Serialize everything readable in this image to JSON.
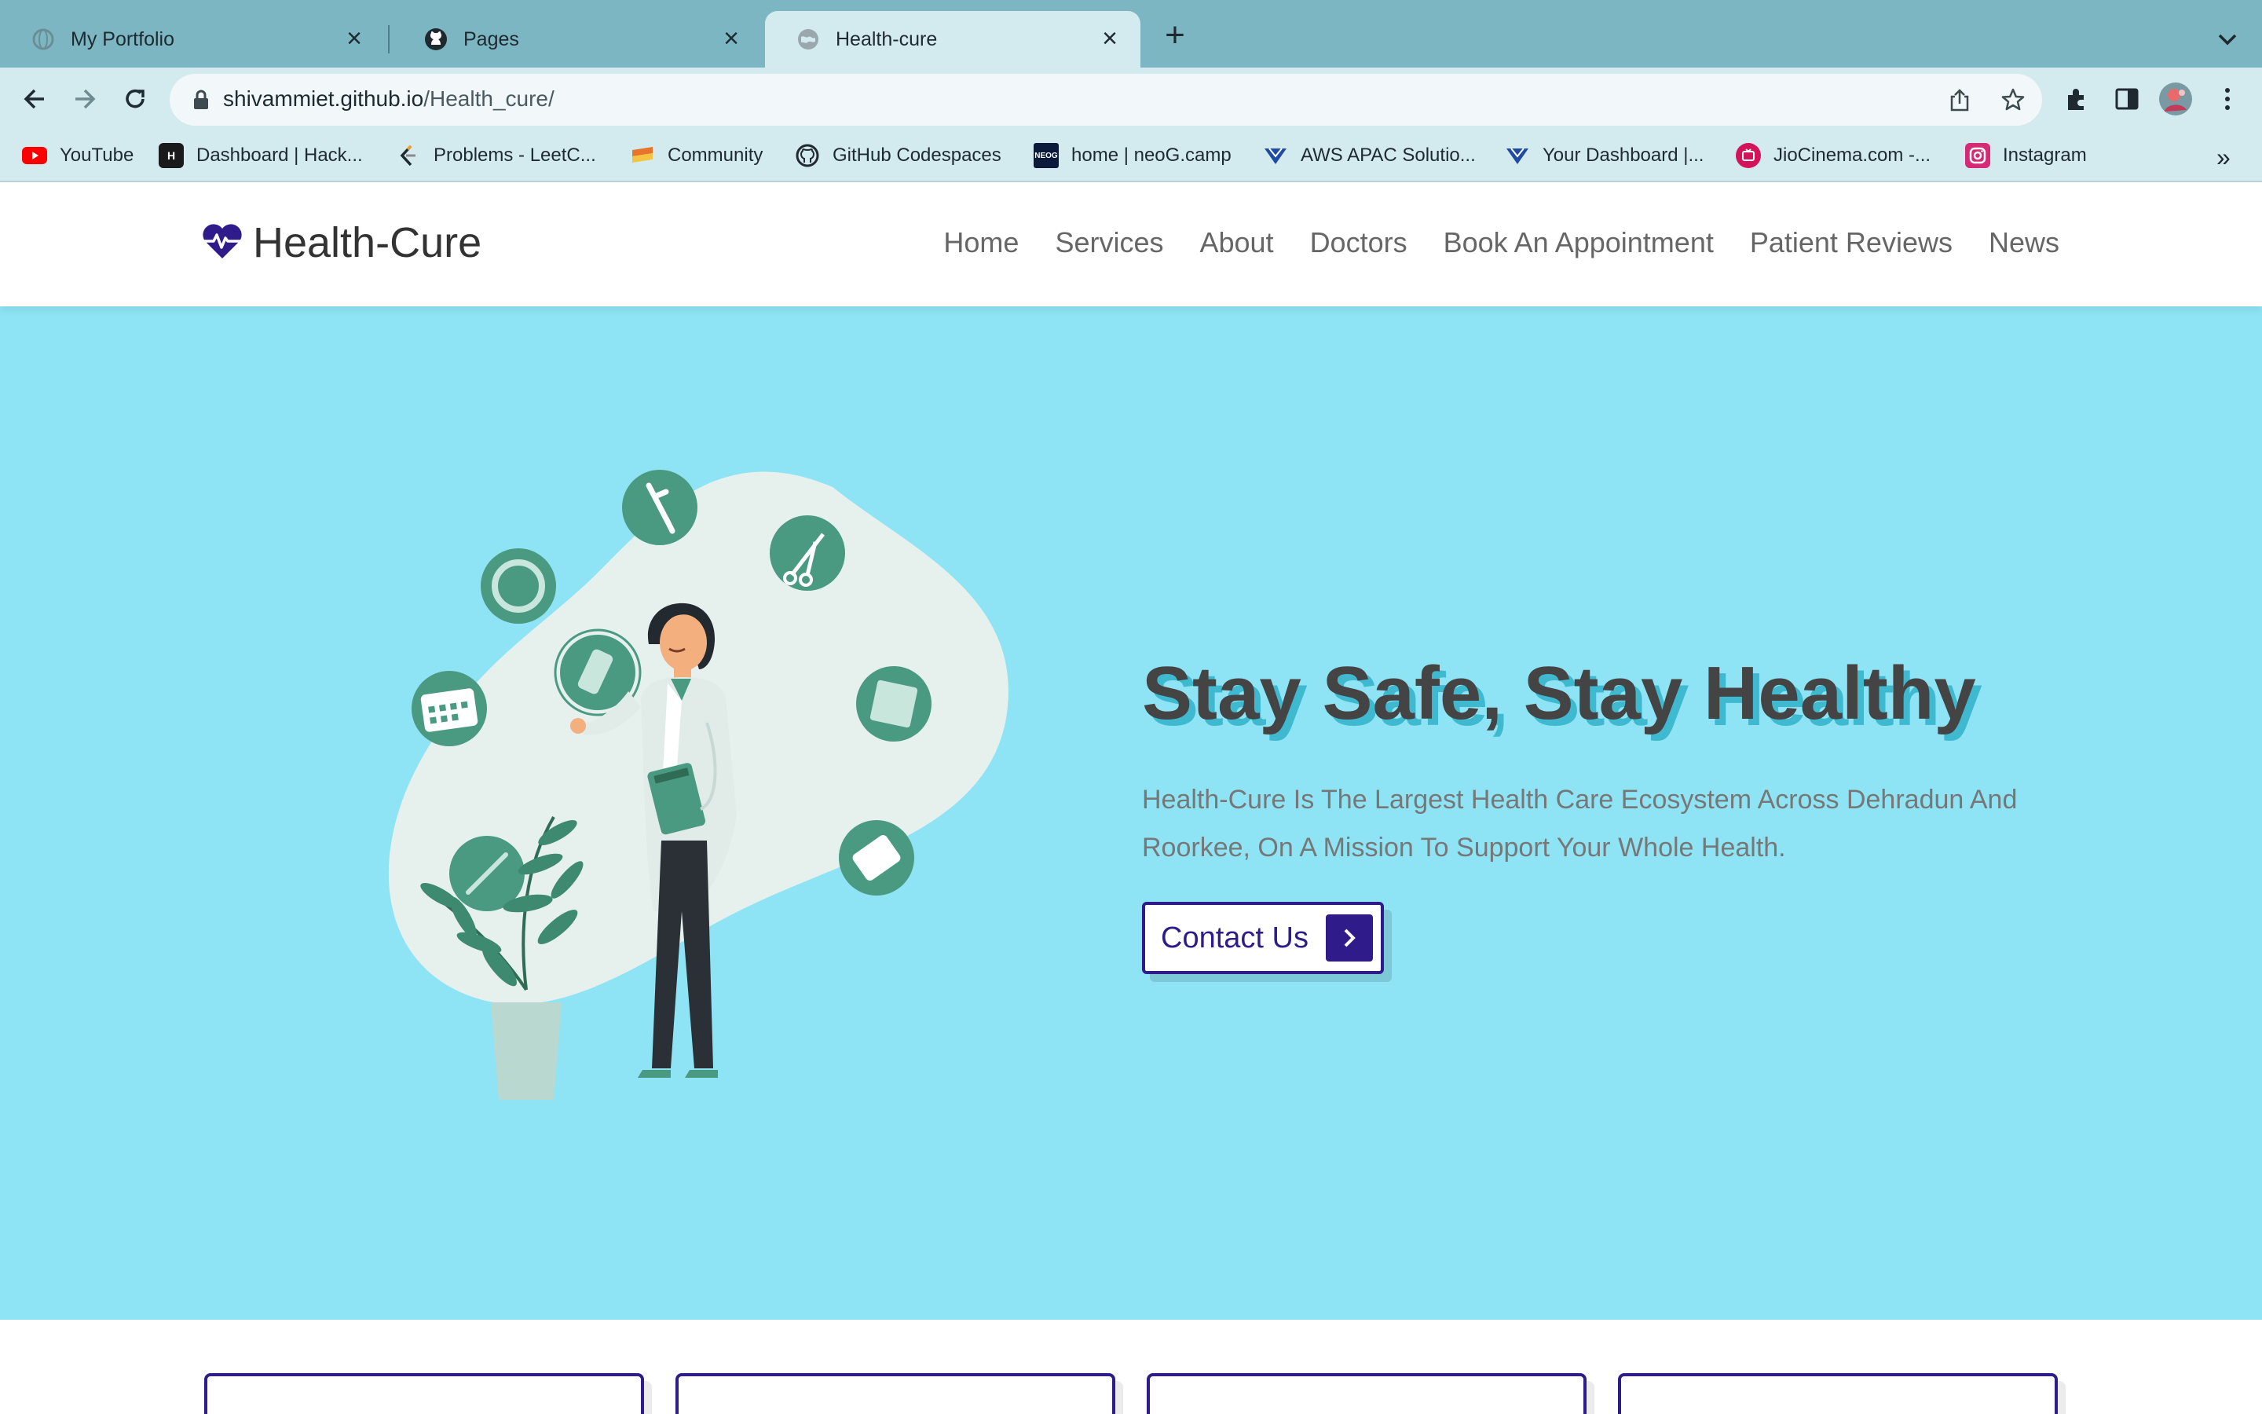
{
  "browser": {
    "tabs": [
      {
        "title": "My Portfolio",
        "icon": "globe-icon",
        "active": false
      },
      {
        "title": "Pages",
        "icon": "github-icon",
        "active": false
      },
      {
        "title": "Health-cure",
        "icon": "globe-icon",
        "active": true
      }
    ],
    "address": {
      "host": "shivammiet.github.io",
      "path": "/Health_cure/"
    },
    "bookmarks": [
      {
        "label": "YouTube",
        "icon": "youtube-icon",
        "color": "#ff0000"
      },
      {
        "label": "Dashboard | Hack...",
        "icon": "hackerrank-icon",
        "color": "#1a1a1a",
        "text": "H"
      },
      {
        "label": "Problems - LeetC...",
        "icon": "leetcode-icon",
        "color": "#f89f1b"
      },
      {
        "label": "Community",
        "icon": "community-icon",
        "color": "#e8742c"
      },
      {
        "label": "GitHub Codespaces",
        "icon": "github-icon",
        "color": "#24292f"
      },
      {
        "label": "home | neoG.camp",
        "icon": "neog-icon",
        "color": "#0b1a3a",
        "text": "NEOG"
      },
      {
        "label": "AWS APAC Solutio...",
        "icon": "aws-icon",
        "color": "#1f4ba5"
      },
      {
        "label": "Your Dashboard |...",
        "icon": "dashboard-icon",
        "color": "#1f4ba5"
      },
      {
        "label": "JioCinema.com -...",
        "icon": "jiocinema-icon",
        "color": "#d3145a"
      },
      {
        "label": "Instagram",
        "icon": "instagram-icon",
        "color": "#d62976"
      }
    ],
    "more_bookmarks": "»"
  },
  "site": {
    "logo": "Health-Cure",
    "nav": [
      "Home",
      "Services",
      "About",
      "Doctors",
      "Book An Appointment",
      "Patient Reviews",
      "News"
    ],
    "hero": {
      "title": "Stay Safe, Stay Healthy",
      "description": "Health-Cure Is The Largest Health Care Ecosystem Across Dehradun And Roorkee, On A Mission To Support Your Whole Health.",
      "button": "Contact Us"
    },
    "colors": {
      "brand": "#2f1c8a",
      "hero_bg": "#8ee4f4",
      "accent_green": "#4a9a82"
    }
  }
}
